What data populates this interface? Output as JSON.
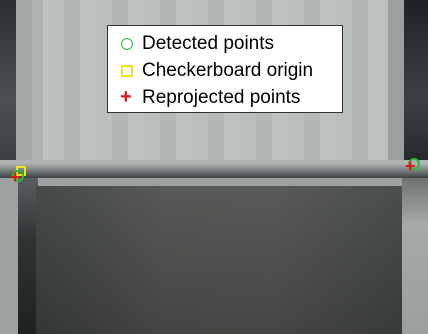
{
  "legend": {
    "items": [
      {
        "label": "Detected points",
        "symbol": "circle-icon",
        "color": "#22c02a"
      },
      {
        "label": "Checkerboard origin",
        "symbol": "square-icon",
        "color": "#f2e21a"
      },
      {
        "label": "Reprojected points",
        "symbol": "plus-icon",
        "color": "#e01616"
      }
    ]
  }
}
